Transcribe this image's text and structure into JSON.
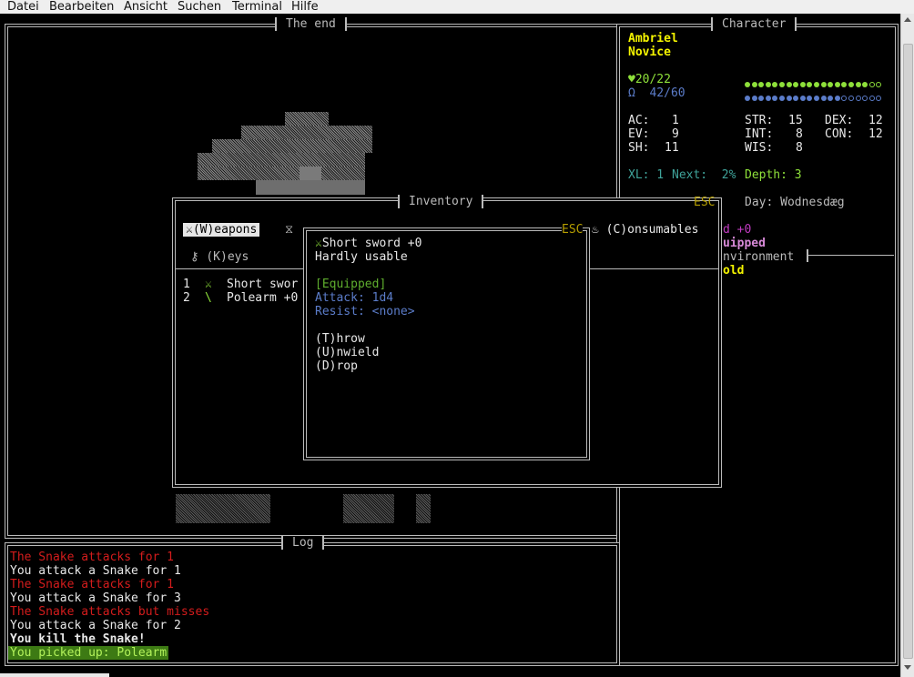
{
  "menu": [
    "Datei",
    "Bearbeiten",
    "Ansicht",
    "Suchen",
    "Terminal",
    "Hilfe"
  ],
  "panels": {
    "map_title": "The end",
    "character_title": "Character",
    "inventory_title": "Inventory",
    "log_title": "Log"
  },
  "character": {
    "name": "Ambriel",
    "rank": "Novice",
    "hp_icon": "♥",
    "hp": "20/22",
    "hp_fraction": 0.91,
    "mp_icon": "Ω",
    "mp": "42/60",
    "mp_fraction": 0.7,
    "stats_left": [
      [
        "AC:",
        "1"
      ],
      [
        "EV:",
        "9"
      ],
      [
        "SH:",
        "11"
      ]
    ],
    "stats_mid": [
      [
        "STR:",
        "15"
      ],
      [
        "INT:",
        "8"
      ],
      [
        "WIS:",
        "8"
      ]
    ],
    "stats_right": [
      [
        "DEX:",
        "12"
      ],
      [
        "CON:",
        "12"
      ]
    ],
    "xl": "XL: 1",
    "next": "Next:  2%",
    "depth": "Depth: 3",
    "day": "Day: Wodnesdæg",
    "partial_lines": [
      "d +0",
      "uipped",
      "nvironment",
      "old"
    ]
  },
  "inventory": {
    "esc": "ESC",
    "tabs": [
      {
        "icon": "crossed-swords-icon",
        "glyph": "⚔",
        "label": "(W)eapons",
        "selected": true
      },
      {
        "icon": "hourglass-icon",
        "glyph": "⧖",
        "label": "",
        "selected": false
      },
      {
        "icon": "potion-icon",
        "glyph": "♨",
        "label": "(C)onsumables",
        "selected": false
      },
      {
        "icon": "key-icon",
        "glyph": "⚷",
        "label": "(K)eys",
        "selected": false
      }
    ],
    "items": [
      {
        "num": "1",
        "glyph": "⚔",
        "name": "Short swor"
      },
      {
        "num": "2",
        "glyph": "\\",
        "name": "Polearm +0"
      }
    ]
  },
  "popup": {
    "esc": "ESC",
    "glyph": "⚔",
    "name": "Short sword +0",
    "quality": "Hardly usable",
    "equipped": "[Equipped]",
    "attack": "Attack: 1d4",
    "resist": "Resist: <none>",
    "actions": [
      "(T)hrow",
      "(U)nwield",
      "(D)rop"
    ]
  },
  "log": [
    {
      "text": "The Snake attacks for 1",
      "kind": "enemy"
    },
    {
      "text": "You attack a Snake for 1",
      "kind": "player"
    },
    {
      "text": "The Snake attacks for 1",
      "kind": "enemy"
    },
    {
      "text": "You attack a Snake for 3",
      "kind": "player"
    },
    {
      "text": "The Snake attacks but misses",
      "kind": "enemy"
    },
    {
      "text": "You attack a Snake for 2",
      "kind": "player"
    },
    {
      "text": "You kill the Snake!",
      "kind": "bold"
    },
    {
      "text": "You picked up: Polearm",
      "kind": "highlight"
    }
  ],
  "colors": {
    "background": "#000000",
    "hp_green": "#8ee03a",
    "mp_blue": "#5b7cc9",
    "name_yellow": "#f4f400",
    "enemy_red": "#d41c1c"
  }
}
